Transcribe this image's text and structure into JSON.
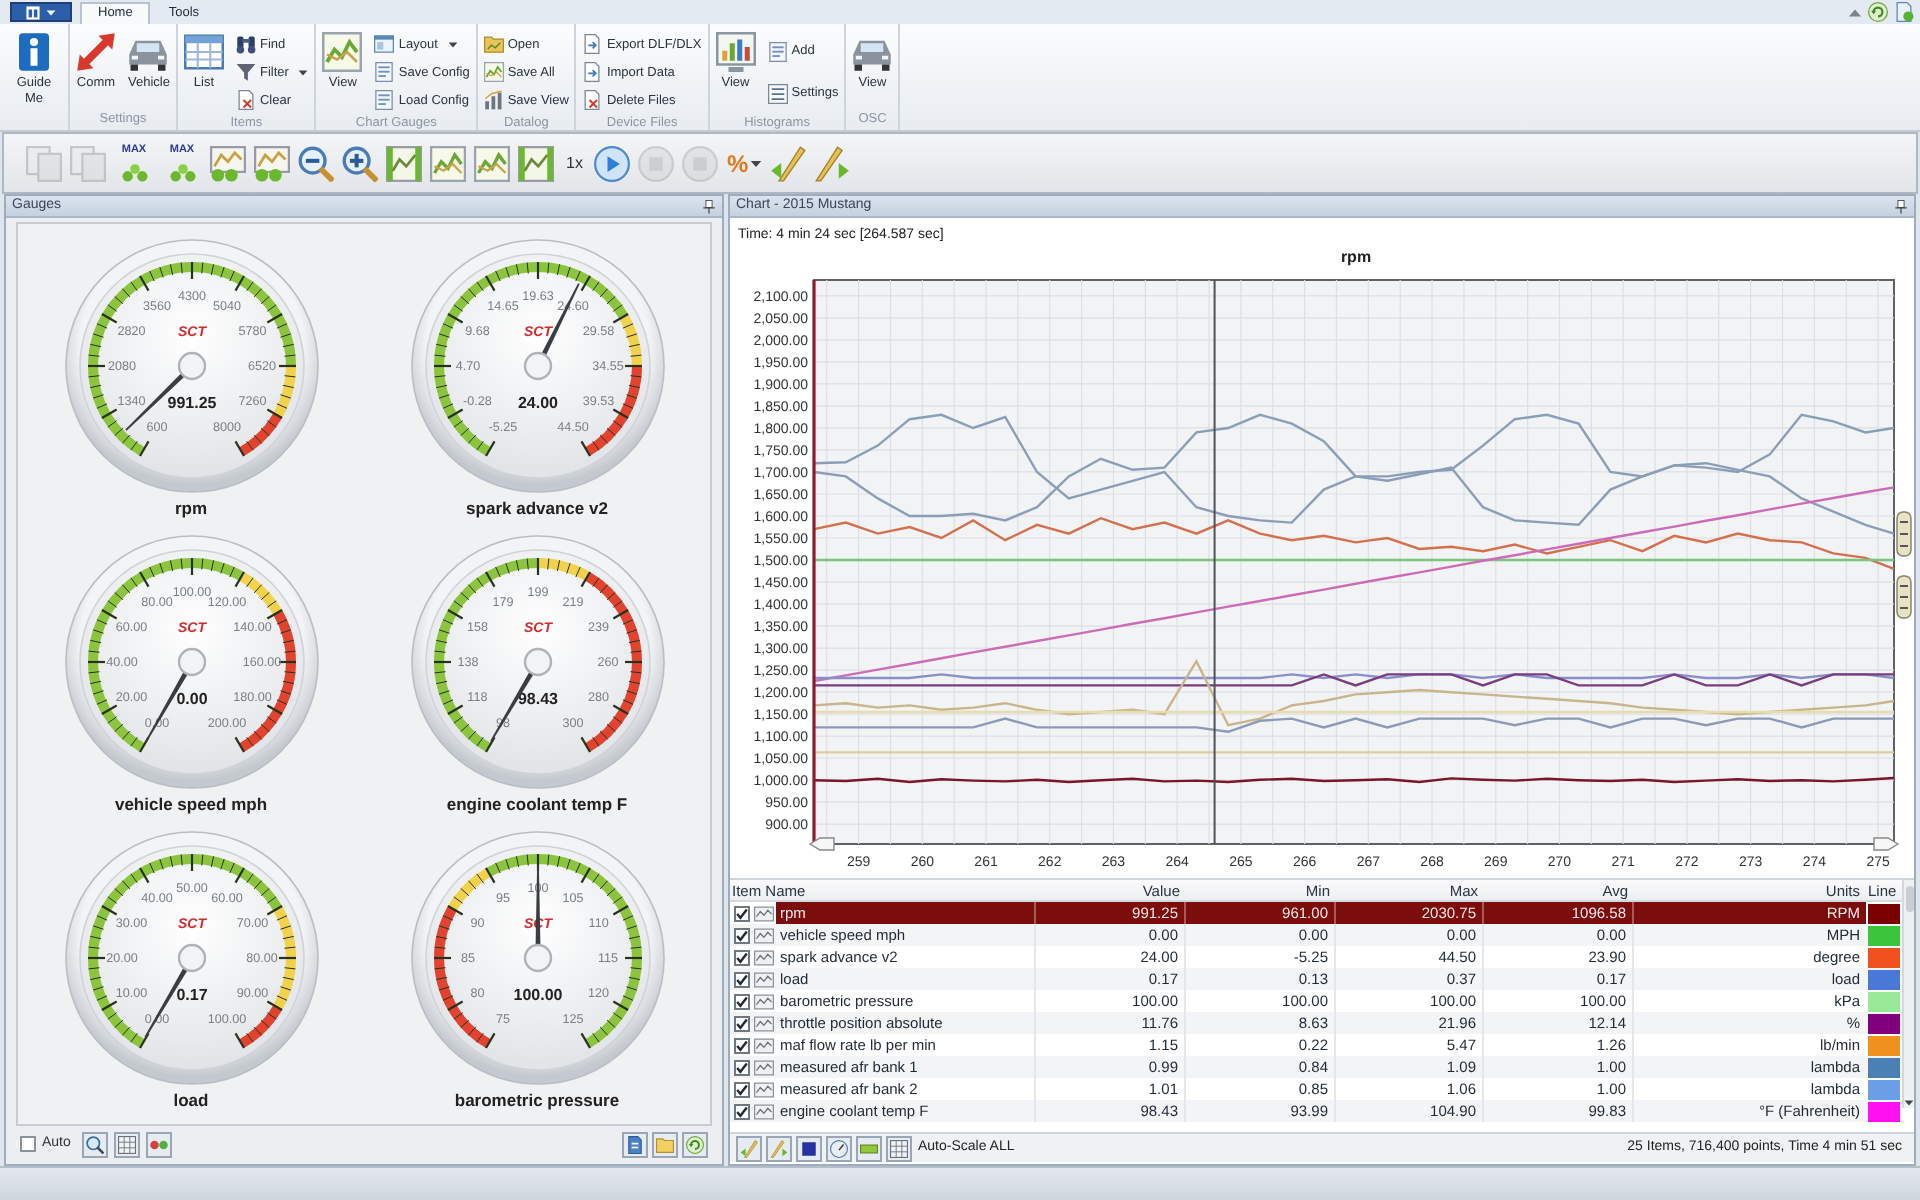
{
  "tabs": [
    {
      "label": "Home",
      "selected": true
    },
    {
      "label": "Tools",
      "selected": false
    }
  ],
  "ribbon": [
    {
      "items": [
        {
          "label": "Guide Me",
          "kind": "large",
          "dropdown": false
        }
      ]
    },
    {
      "label": "Settings",
      "items": [
        {
          "label": "Comm",
          "kind": "large",
          "dropdown": false
        },
        {
          "label": "Vehicle",
          "kind": "large",
          "dropdown": false
        }
      ]
    },
    {
      "label": "Items",
      "items": [
        {
          "label": "List",
          "kind": "large",
          "dropdown": false
        },
        {
          "label": "Find",
          "kind": "small",
          "dropdown": false
        },
        {
          "label": "Filter",
          "kind": "small",
          "dropdown": true
        },
        {
          "label": "Clear",
          "kind": "small",
          "dropdown": false
        }
      ]
    },
    {
      "label": "Chart Gauges",
      "items": [
        {
          "label": "View",
          "kind": "large",
          "dropdown": false
        },
        {
          "label": "Layout",
          "kind": "small",
          "dropdown": true
        },
        {
          "label": "Save Config",
          "kind": "small",
          "dropdown": false
        },
        {
          "label": "Load Config",
          "kind": "small",
          "dropdown": false
        }
      ]
    },
    {
      "label": "Datalog",
      "items": [
        {
          "label": "Open",
          "kind": "small",
          "dropdown": false
        },
        {
          "label": "Save All",
          "kind": "small",
          "dropdown": false
        },
        {
          "label": "Save View",
          "kind": "small",
          "dropdown": false
        }
      ]
    },
    {
      "label": "Device Files",
      "items": [
        {
          "label": "Export DLF/DLX",
          "kind": "small",
          "dropdown": false
        },
        {
          "label": "Import Data",
          "kind": "small",
          "dropdown": false
        },
        {
          "label": "Delete Files",
          "kind": "small",
          "dropdown": false
        }
      ]
    },
    {
      "label": "Histograms",
      "items": [
        {
          "label": "View",
          "kind": "large",
          "dropdown": false
        },
        {
          "label": "Add",
          "kind": "small",
          "dropdown": false
        },
        {
          "label": "Settings",
          "kind": "small",
          "dropdown": false
        }
      ]
    },
    {
      "label": "OSC",
      "items": [
        {
          "label": "View",
          "kind": "large",
          "dropdown": false
        }
      ]
    }
  ],
  "toolbar": [
    {
      "kind": "button",
      "disabled": true,
      "dropdown": false
    },
    {
      "kind": "button",
      "disabled": true,
      "dropdown": false
    },
    {
      "kind": "button",
      "label": "MAX",
      "disabled": false,
      "dropdown": false
    },
    {
      "kind": "button",
      "label": "MAX",
      "disabled": false,
      "dropdown": false
    },
    {
      "kind": "button",
      "disabled": false,
      "dropdown": false
    },
    {
      "kind": "button",
      "disabled": false,
      "dropdown": false
    },
    {
      "kind": "button",
      "disabled": false,
      "dropdown": false
    },
    {
      "kind": "button",
      "disabled": false,
      "dropdown": false
    },
    {
      "kind": "button",
      "disabled": false,
      "dropdown": false
    },
    {
      "kind": "button",
      "disabled": false,
      "dropdown": false
    },
    {
      "kind": "button",
      "disabled": false,
      "dropdown": false
    },
    {
      "kind": "button",
      "disabled": false,
      "dropdown": false
    },
    {
      "kind": "text",
      "label": "1x",
      "disabled": false,
      "dropdown": false
    },
    {
      "kind": "button",
      "disabled": false,
      "dropdown": false
    },
    {
      "kind": "button",
      "disabled": true,
      "dropdown": false
    },
    {
      "kind": "button",
      "disabled": true,
      "dropdown": false
    },
    {
      "kind": "button",
      "label": "%",
      "disabled": false,
      "dropdown": true
    },
    {
      "kind": "button",
      "disabled": false,
      "dropdown": false
    },
    {
      "kind": "button",
      "disabled": false,
      "dropdown": false
    }
  ],
  "gauges_panel": {
    "title": "Gauges",
    "gauges": [
      {
        "label": "rpm",
        "value": "991.25",
        "logo": "SCT",
        "scale": [
          "600",
          "1340",
          "2080",
          "2820",
          "3560",
          "4300",
          "5040",
          "5780",
          "6520",
          "7260",
          "8000"
        ],
        "zones": [
          {
            "color": "#8dc43e"
          },
          {
            "color": "#8dc43e"
          },
          {
            "color": "#8dc43e"
          },
          {
            "color": "#8dc43e"
          },
          {
            "color": "#8dc43e"
          },
          {
            "color": "#8dc43e"
          },
          {
            "color": "#8dc43e"
          },
          {
            "color": "#8dc43e"
          },
          {
            "color": "#f2d24a"
          },
          {
            "color": "#e2432f"
          }
        ]
      },
      {
        "label": "spark advance v2",
        "value": "24.00",
        "logo": "SCT",
        "scale": [
          "-5.25",
          "-0.28",
          "4.70",
          "9.68",
          "14.65",
          "19.63",
          "24.60",
          "29.58",
          "34.55",
          "39.53",
          "44.50"
        ],
        "zones": [
          {
            "color": "#8dc43e"
          },
          {
            "color": "#8dc43e"
          },
          {
            "color": "#8dc43e"
          },
          {
            "color": "#8dc43e"
          },
          {
            "color": "#8dc43e"
          },
          {
            "color": "#8dc43e"
          },
          {
            "color": "#8dc43e"
          },
          {
            "color": "#f2d24a"
          },
          {
            "color": "#e2432f"
          },
          {
            "color": "#e2432f"
          }
        ]
      },
      {
        "label": "vehicle speed mph",
        "value": "0.00",
        "logo": "SCT",
        "scale": [
          "0.00",
          "20.00",
          "40.00",
          "60.00",
          "80.00",
          "100.00",
          "120.00",
          "140.00",
          "160.00",
          "180.00",
          "200.00"
        ],
        "zones": [
          {
            "color": "#8dc43e"
          },
          {
            "color": "#8dc43e"
          },
          {
            "color": "#8dc43e"
          },
          {
            "color": "#8dc43e"
          },
          {
            "color": "#8dc43e"
          },
          {
            "color": "#8dc43e"
          },
          {
            "color": "#f2d24a"
          },
          {
            "color": "#e2432f"
          },
          {
            "color": "#e2432f"
          },
          {
            "color": "#e2432f"
          }
        ]
      },
      {
        "label": "engine coolant temp F",
        "value": "98.43",
        "logo": "SCT",
        "scale": [
          "98",
          "118",
          "138",
          "158",
          "179",
          "199",
          "219",
          "239",
          "260",
          "280",
          "300"
        ],
        "zones": [
          {
            "color": "#8dc43e"
          },
          {
            "color": "#8dc43e"
          },
          {
            "color": "#8dc43e"
          },
          {
            "color": "#8dc43e"
          },
          {
            "color": "#8dc43e"
          },
          {
            "color": "#f2d24a"
          },
          {
            "color": "#e2432f"
          },
          {
            "color": "#e2432f"
          },
          {
            "color": "#e2432f"
          },
          {
            "color": "#e2432f"
          }
        ]
      },
      {
        "label": "load",
        "value": "0.17",
        "logo": "SCT",
        "scale": [
          "0.00",
          "10.00",
          "20.00",
          "30.00",
          "40.00",
          "50.00",
          "60.00",
          "70.00",
          "80.00",
          "90.00",
          "100.00"
        ],
        "zones": [
          {
            "color": "#8dc43e"
          },
          {
            "color": "#8dc43e"
          },
          {
            "color": "#8dc43e"
          },
          {
            "color": "#8dc43e"
          },
          {
            "color": "#8dc43e"
          },
          {
            "color": "#8dc43e"
          },
          {
            "color": "#8dc43e"
          },
          {
            "color": "#f2d24a"
          },
          {
            "color": "#f2d24a"
          },
          {
            "color": "#e2432f"
          }
        ]
      },
      {
        "label": "barometric pressure",
        "value": "100.00",
        "logo": "SCT",
        "scale": [
          "75",
          "80",
          "85",
          "90",
          "95",
          "100",
          "105",
          "110",
          "115",
          "120",
          "125"
        ],
        "zones": [
          {
            "color": "#e2432f"
          },
          {
            "color": "#e2432f"
          },
          {
            "color": "#e2432f"
          },
          {
            "color": "#f2d24a"
          },
          {
            "color": "#8dc43e"
          },
          {
            "color": "#8dc43e"
          },
          {
            "color": "#8dc43e"
          },
          {
            "color": "#8dc43e"
          },
          {
            "color": "#8dc43e"
          },
          {
            "color": "#8dc43e"
          }
        ]
      }
    ],
    "auto": {
      "label": "Auto",
      "checked": false
    }
  },
  "chart_panel": {
    "title": "Chart - 2015 Mustang",
    "time": "Time: 4 min 24 sec [264.587 sec]",
    "chart_data": {
      "type": "line",
      "title": "rpm",
      "x": [
        258.3,
        258.8,
        259.3,
        259.8,
        260.3,
        260.8,
        261.3,
        261.8,
        262.3,
        262.8,
        263.3,
        263.8,
        264.3,
        264.8,
        265.3,
        265.8,
        266.3,
        266.8,
        267.3,
        267.8,
        268.3,
        268.8,
        269.3,
        269.8,
        270.3,
        270.8,
        271.3,
        271.8,
        272.3,
        272.8,
        273.3,
        273.8,
        274.3,
        274.8,
        275.25
      ],
      "series": [
        {
          "color": "#8c9db8",
          "values": [
            1720,
            1722,
            1760,
            1820,
            1830,
            1800,
            1825,
            1700,
            1640,
            1660,
            1680,
            1700,
            1620,
            1600,
            1590,
            1585,
            1660,
            1690,
            1690,
            1700,
            1705,
            1760,
            1820,
            1830,
            1810,
            1700,
            1690,
            1715,
            1710,
            1700,
            1740,
            1830,
            1815,
            1790,
            1800
          ]
        },
        {
          "color": "#8c9db8",
          "values": [
            1700,
            1690,
            1640,
            1600,
            1600,
            1605,
            1590,
            1620,
            1690,
            1730,
            1705,
            1710,
            1790,
            1800,
            1830,
            1810,
            1770,
            1690,
            1680,
            1695,
            1710,
            1620,
            1590,
            1585,
            1580,
            1660,
            1690,
            1715,
            1720,
            1705,
            1690,
            1640,
            1610,
            1580,
            1560
          ]
        },
        {
          "color": "#d4704e",
          "values": [
            1570,
            1585,
            1560,
            1575,
            1550,
            1590,
            1545,
            1580,
            1560,
            1595,
            1570,
            1585,
            1560,
            1590,
            1560,
            1545,
            1555,
            1540,
            1550,
            1525,
            1530,
            1520,
            1535,
            1515,
            1530,
            1545,
            1520,
            1555,
            1540,
            1560,
            1545,
            1540,
            1515,
            1505,
            1480
          ]
        },
        {
          "color": "#7cc47c",
          "values": [
            1500,
            1500,
            1500,
            1500,
            1500,
            1500,
            1500,
            1500,
            1500,
            1500,
            1500,
            1500,
            1500,
            1500,
            1500,
            1500,
            1500,
            1500,
            1500,
            1500,
            1500,
            1500,
            1500,
            1500,
            1500,
            1500,
            1500,
            1500,
            1500,
            1500,
            1500,
            1500,
            1500,
            1500,
            1500
          ]
        },
        {
          "color": "#cc6cb8",
          "values": [
            1225,
            1238,
            1251,
            1264,
            1277,
            1290,
            1303,
            1316,
            1329,
            1342,
            1355,
            1368,
            1381,
            1394,
            1407,
            1420,
            1433,
            1446,
            1459,
            1472,
            1485,
            1498,
            1511,
            1524,
            1537,
            1550,
            1563,
            1576,
            1589,
            1602,
            1615,
            1628,
            1641,
            1654,
            1665
          ]
        },
        {
          "color": "#8890c8",
          "values": [
            1232,
            1232,
            1232,
            1232,
            1240,
            1232,
            1232,
            1232,
            1232,
            1232,
            1232,
            1232,
            1232,
            1232,
            1232,
            1240,
            1232,
            1240,
            1232,
            1240,
            1240,
            1232,
            1240,
            1232,
            1232,
            1232,
            1232,
            1240,
            1232,
            1232,
            1240,
            1232,
            1240,
            1240,
            1232
          ]
        },
        {
          "color": "#7a3c80",
          "values": [
            1215,
            1215,
            1215,
            1215,
            1215,
            1215,
            1215,
            1215,
            1215,
            1215,
            1215,
            1215,
            1215,
            1215,
            1215,
            1215,
            1240,
            1215,
            1240,
            1240,
            1240,
            1215,
            1240,
            1240,
            1215,
            1215,
            1215,
            1240,
            1215,
            1215,
            1240,
            1215,
            1240,
            1240,
            1240
          ]
        },
        {
          "color": "#c9b48c",
          "values": [
            1170,
            1175,
            1165,
            1170,
            1160,
            1165,
            1175,
            1160,
            1150,
            1155,
            1160,
            1150,
            1270,
            1125,
            1140,
            1170,
            1180,
            1195,
            1200,
            1205,
            1200,
            1195,
            1190,
            1185,
            1180,
            1175,
            1165,
            1160,
            1155,
            1150,
            1155,
            1160,
            1165,
            1170,
            1180
          ]
        },
        {
          "color": "#e8dcae",
          "values": [
            1155,
            1155,
            1155,
            1155,
            1155,
            1155,
            1155,
            1155,
            1155,
            1155,
            1155,
            1155,
            1155,
            1155,
            1155,
            1155,
            1155,
            1155,
            1155,
            1155,
            1155,
            1155,
            1155,
            1155,
            1155,
            1155,
            1155,
            1155,
            1155,
            1155,
            1155,
            1155,
            1155,
            1155,
            1155
          ]
        },
        {
          "color": "#8c9ab8",
          "values": [
            1120,
            1120,
            1120,
            1120,
            1120,
            1120,
            1140,
            1120,
            1120,
            1120,
            1120,
            1120,
            1120,
            1110,
            1135,
            1140,
            1120,
            1140,
            1120,
            1140,
            1140,
            1140,
            1125,
            1140,
            1140,
            1120,
            1140,
            1140,
            1125,
            1140,
            1140,
            1120,
            1140,
            1140,
            1140
          ]
        },
        {
          "color": "#dccca0",
          "values": [
            1063,
            1063,
            1063,
            1063,
            1063,
            1063,
            1063,
            1063,
            1063,
            1063,
            1063,
            1063,
            1063,
            1063,
            1063,
            1063,
            1063,
            1063,
            1063,
            1063,
            1063,
            1063,
            1063,
            1063,
            1063,
            1063,
            1063,
            1063,
            1063,
            1063,
            1063,
            1063,
            1063,
            1063,
            1063
          ]
        },
        {
          "color": "#7a1628",
          "values": [
            1000,
            998,
            1003,
            996,
            1002,
            999,
            997,
            1001,
            996,
            1000,
            1003,
            997,
            999,
            996,
            1001,
            1003,
            998,
            1000,
            1002,
            996,
            1004,
            1001,
            999,
            1003,
            1000,
            998,
            1001,
            996,
            999,
            1002,
            998,
            1000,
            997,
            1001,
            1005
          ]
        }
      ],
      "xlim": [
        258.3,
        275.25
      ],
      "ylim": [
        855,
        2136
      ],
      "grid": true,
      "xticks": [
        259,
        260,
        261,
        262,
        263,
        264,
        265,
        266,
        267,
        268,
        269,
        270,
        271,
        272,
        273,
        274,
        275
      ],
      "yticks": [
        {
          "value": 900,
          "label": "900.00"
        },
        {
          "value": 950,
          "label": "950.00"
        },
        {
          "value": 1000,
          "label": "1,000.00"
        },
        {
          "value": 1050,
          "label": "1,050.00"
        },
        {
          "value": 1100,
          "label": "1,100.00"
        },
        {
          "value": 1150,
          "label": "1,150.00"
        },
        {
          "value": 1200,
          "label": "1,200.00"
        },
        {
          "value": 1250,
          "label": "1,250.00"
        },
        {
          "value": 1300,
          "label": "1,300.00"
        },
        {
          "value": 1350,
          "label": "1,350.00"
        },
        {
          "value": 1400,
          "label": "1,400.00"
        },
        {
          "value": 1450,
          "label": "1,450.00"
        },
        {
          "value": 1500,
          "label": "1,500.00"
        },
        {
          "value": 1550,
          "label": "1,550.00"
        },
        {
          "value": 1600,
          "label": "1,600.00"
        },
        {
          "value": 1650,
          "label": "1,650.00"
        },
        {
          "value": 1700,
          "label": "1,700.00"
        },
        {
          "value": 1750,
          "label": "1,750.00"
        },
        {
          "value": 1800,
          "label": "1,800.00"
        },
        {
          "value": 1850,
          "label": "1,850.00"
        },
        {
          "value": 1900,
          "label": "1,900.00"
        },
        {
          "value": 1950,
          "label": "1,950.00"
        },
        {
          "value": 2000,
          "label": "2,000.00"
        },
        {
          "value": 2050,
          "label": "2,050.00"
        },
        {
          "value": 2100,
          "label": "2,100.00"
        }
      ],
      "ref_lines": [
        {
          "axis": "x",
          "value": 264.587
        }
      ]
    },
    "table": {
      "columns": [
        "Item Name",
        "Value",
        "Min",
        "Max",
        "Avg",
        "Units",
        "Line"
      ],
      "rows": [
        {
          "checked": true,
          "selected": true,
          "name": "rpm",
          "value": "991.25",
          "min": "961.00",
          "max": "2030.75",
          "avg": "1096.58",
          "units": "RPM",
          "color": "#7b0000"
        },
        {
          "checked": true,
          "selected": false,
          "name": "vehicle speed mph",
          "value": "0.00",
          "min": "0.00",
          "max": "0.00",
          "avg": "0.00",
          "units": "MPH",
          "color": "#3cc43c"
        },
        {
          "checked": true,
          "selected": false,
          "name": "spark advance v2",
          "value": "24.00",
          "min": "-5.25",
          "max": "44.50",
          "avg": "23.90",
          "units": "degree",
          "color": "#f0501e"
        },
        {
          "checked": true,
          "selected": false,
          "name": "load",
          "value": "0.17",
          "min": "0.13",
          "max": "0.37",
          "avg": "0.17",
          "units": "load",
          "color": "#4a78d8"
        },
        {
          "checked": true,
          "selected": false,
          "name": "barometric pressure",
          "value": "100.00",
          "min": "100.00",
          "max": "100.00",
          "avg": "100.00",
          "units": "kPa",
          "color": "#98e898"
        },
        {
          "checked": true,
          "selected": false,
          "name": "throttle position absolute",
          "value": "11.76",
          "min": "8.63",
          "max": "21.96",
          "avg": "12.14",
          "units": "%",
          "color": "#800080"
        },
        {
          "checked": true,
          "selected": false,
          "name": "maf flow rate lb per min",
          "value": "1.15",
          "min": "0.22",
          "max": "5.47",
          "avg": "1.26",
          "units": "lb/min",
          "color": "#f0901e"
        },
        {
          "checked": true,
          "selected": false,
          "name": "measured afr bank 1",
          "value": "0.99",
          "min": "0.84",
          "max": "1.09",
          "avg": "1.00",
          "units": "lambda",
          "color": "#4a80b4"
        },
        {
          "checked": true,
          "selected": false,
          "name": "measured afr bank 2",
          "value": "1.01",
          "min": "0.85",
          "max": "1.06",
          "avg": "1.00",
          "units": "lambda",
          "color": "#6a9ee6"
        },
        {
          "checked": true,
          "selected": false,
          "name": "engine coolant temp F",
          "value": "98.43",
          "min": "93.99",
          "max": "104.90",
          "avg": "99.83",
          "units": "°F (Fahrenheit)",
          "color": "#ff10f0"
        }
      ]
    },
    "footer": {
      "auto_scale": "Auto-Scale ALL",
      "summary": "25 Items, 716,400 points, Time 4 min 51 sec"
    }
  }
}
